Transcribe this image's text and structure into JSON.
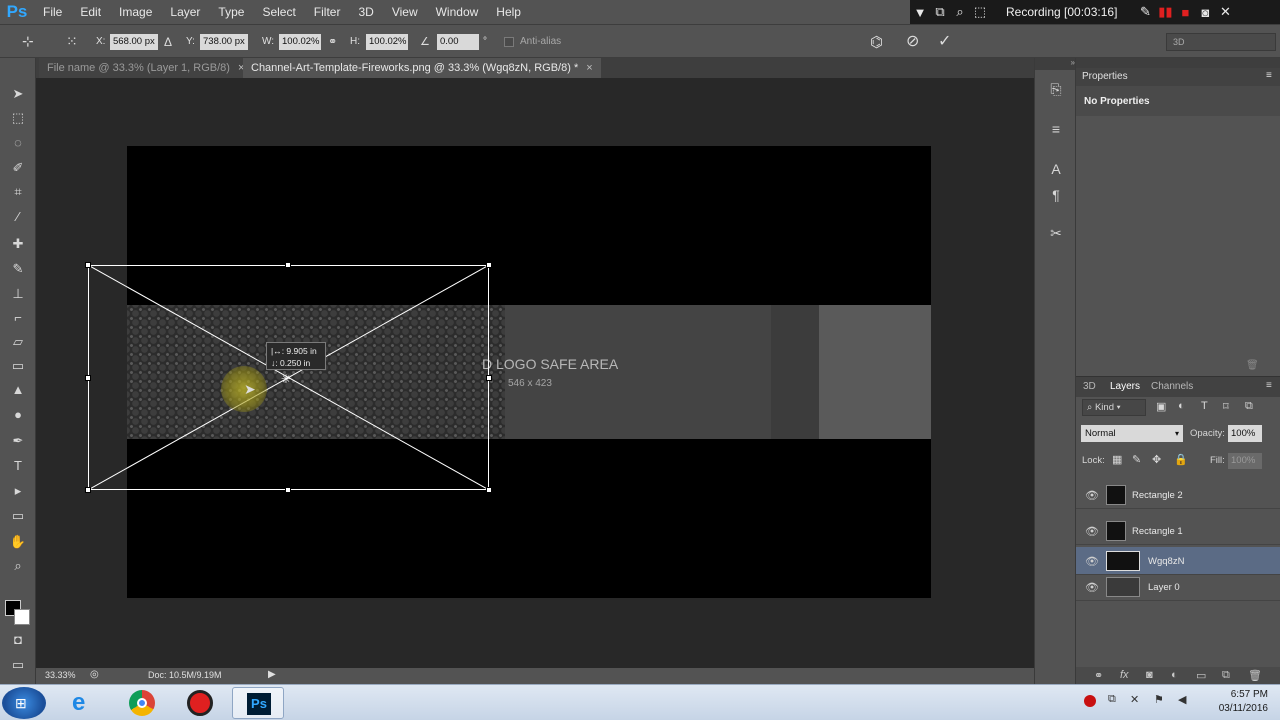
{
  "app": {
    "logo": "Ps"
  },
  "menu": [
    "File",
    "Edit",
    "Image",
    "Layer",
    "Type",
    "Select",
    "Filter",
    "3D",
    "View",
    "Window",
    "Help"
  ],
  "recording": {
    "label": "Recording [00:03:16]"
  },
  "options": {
    "x_label": "X:",
    "x_value": "568.00 px",
    "y_label": "Y:",
    "y_value": "738.00 px",
    "w_label": "W:",
    "w_value": "100.02%",
    "h_label": "H:",
    "h_value": "100.02%",
    "angle_value": "0.00",
    "angle_unit": "°",
    "antialias_label": "Anti-alias",
    "workspace": "3D"
  },
  "tabs": [
    {
      "label": "File name @ 33.3% (Layer 1, RGB/8)",
      "close": "×"
    },
    {
      "label": "Channel-Art-Template-Fireworks.png @ 33.3% (Wgq8zN, RGB/8) *",
      "close": "×"
    }
  ],
  "canvas": {
    "safe_area_title": "D LOGO SAFE AREA",
    "safe_area_dims": "546 x 423",
    "tooltip_line1": "|↔: 9.905 in",
    "tooltip_line2": "↓: 0.250 in"
  },
  "status": {
    "zoom": "33.33%",
    "doc": "Doc: 10.5M/9.19M"
  },
  "properties": {
    "tab": "Properties",
    "body": "No Properties"
  },
  "layers_panel": {
    "tabs": [
      "3D",
      "Layers",
      "Channels"
    ],
    "kind": "Kind",
    "blend_mode": "Normal",
    "opacity_label": "Opacity:",
    "opacity_value": "100%",
    "lock_label": "Lock:",
    "fill_label": "Fill:",
    "fill_value": "100%",
    "layers": [
      {
        "name": "Rectangle 2",
        "selected": false
      },
      {
        "name": "Rectangle 1",
        "selected": false
      },
      {
        "name": "Wgq8zN",
        "selected": true
      },
      {
        "name": "Layer 0",
        "selected": false
      }
    ]
  },
  "taskbar": {
    "time": "6:57 PM",
    "date": "03/11/2016"
  },
  "colors": {
    "ps_blue": "#31a8ff",
    "selection": "#5b6b85",
    "record_red": "#e02020"
  }
}
